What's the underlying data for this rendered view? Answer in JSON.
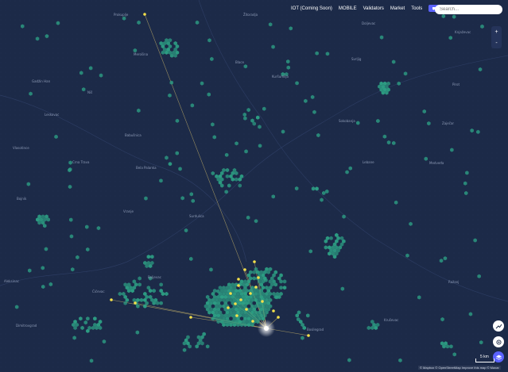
{
  "nav": {
    "items": [
      "IOT (Coming Soon)",
      "MOBILE",
      "Validators",
      "Market",
      "Tools"
    ]
  },
  "search": {
    "placeholder": "Search..."
  },
  "zoom": {
    "in": "+",
    "out": "-"
  },
  "scale": {
    "label": "5 km"
  },
  "attribution": "© Mapbox © OpenStreetMap Improve this map © Maxar",
  "colors": {
    "background": "#1c2a48",
    "hex_fill": "#2d9f84",
    "beacon": "#f4e04a",
    "line": "#c9b56a",
    "accent": "#5b63ff"
  },
  "places": [
    "Prokuplje",
    "Žitoradja",
    "Doljevac",
    "Merošina",
    "Blace",
    "Kuršumlija",
    "Gadžin Han",
    "Niš",
    "Svrljig",
    "Knjaževac",
    "Leskovac",
    "Vlasotince",
    "Babušnica",
    "Pirot",
    "Bela Palanka",
    "Crna Trava",
    "Lebane",
    "Medveđa",
    "Bojnik",
    "Vranje",
    "Surdulica",
    "Sokobanja",
    "Zaječar",
    "Boljevac",
    "Aleksinac",
    "Ražanj",
    "Ćićevac",
    "Kruševac",
    "Dimitrovgrad",
    "Bosilegrad"
  ],
  "icons": {
    "chat": "chat-icon",
    "bell": "bell-icon",
    "trend": "trend-icon",
    "locate": "locate-icon",
    "layers": "layers-icon"
  }
}
